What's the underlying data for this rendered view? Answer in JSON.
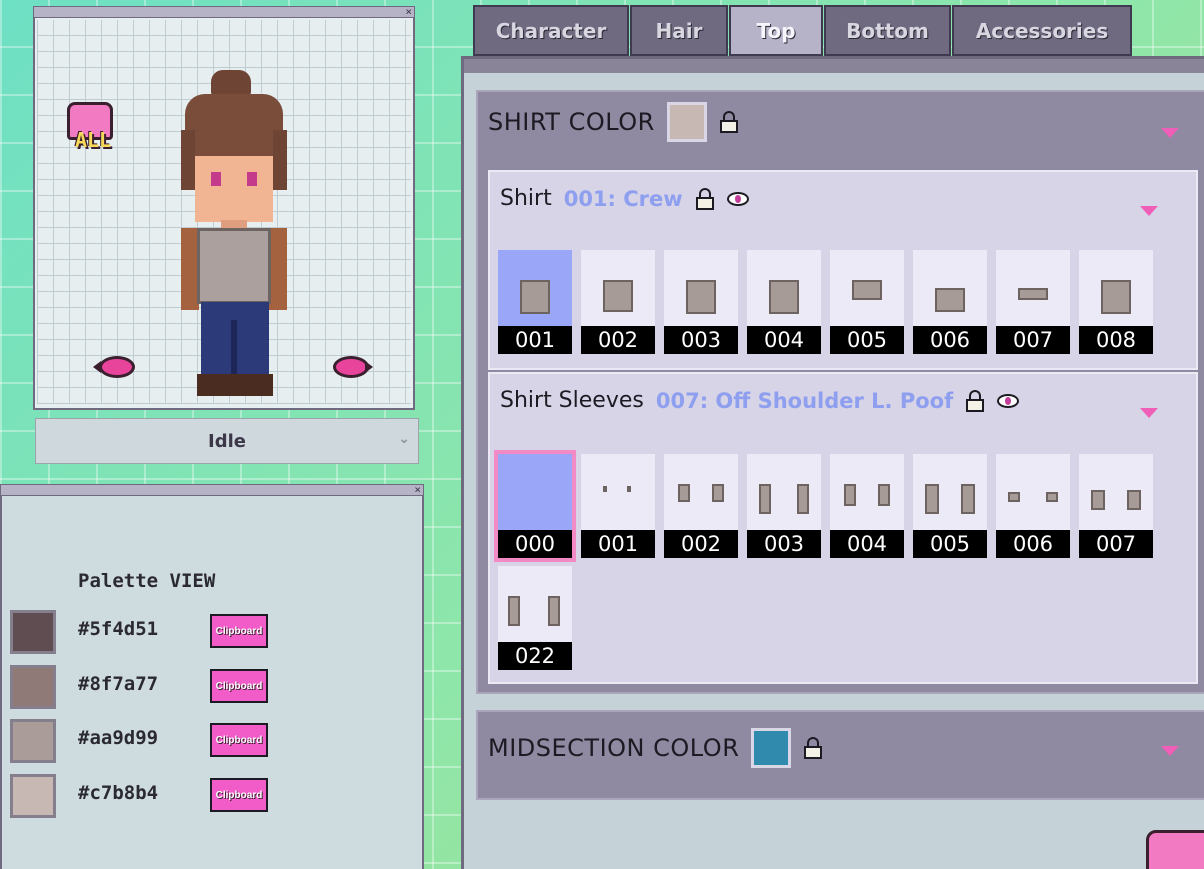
{
  "preview": {
    "all_label": "ALL",
    "animation": "Idle"
  },
  "palette": {
    "title": "Palette VIEW",
    "clipboard_label": "Clipboard",
    "colors": [
      "#5f4d51",
      "#8f7a77",
      "#aa9d99",
      "#c7b8b4"
    ]
  },
  "tabs": [
    {
      "label": "Character",
      "active": false
    },
    {
      "label": "Hair",
      "active": false
    },
    {
      "label": "Top",
      "active": true
    },
    {
      "label": "Bottom",
      "active": false
    },
    {
      "label": "Accessories",
      "active": false
    }
  ],
  "shirt_color": {
    "title": "SHIRT COLOR",
    "swatch": "#c7b8b4"
  },
  "shirt": {
    "title": "Shirt",
    "selected": "001: Crew",
    "options": [
      "001",
      "002",
      "003",
      "004",
      "005",
      "006",
      "007",
      "008"
    ]
  },
  "sleeves": {
    "title": "Shirt Sleeves",
    "selected": "007: Off Shoulder L. Poof",
    "options": [
      "000",
      "001",
      "002",
      "003",
      "004",
      "005",
      "006",
      "007",
      "022"
    ]
  },
  "midsection_color": {
    "title": "MIDSECTION COLOR",
    "swatch": "#2f8aad"
  },
  "colors": {
    "accent_pink": "#f05fb7",
    "selected_tile": "#9aa6f7",
    "selected_name": "#8f9ff0"
  }
}
